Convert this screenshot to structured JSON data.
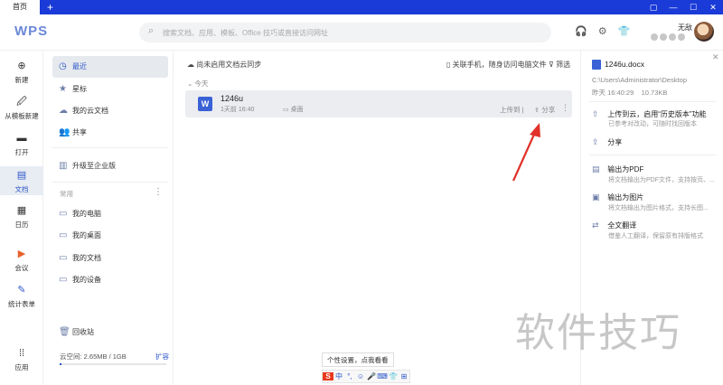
{
  "titlebar": {
    "home_tab": "首页",
    "new_tab_label": "+"
  },
  "header": {
    "logo": "WPS",
    "search_placeholder": "搜索文档、应用、模板、Office 技巧或直接访问网址",
    "user_name": "无敌"
  },
  "leftnav": {
    "items": [
      {
        "label": "新建",
        "icon": "plus-circle-icon"
      },
      {
        "label": "从模板新建",
        "icon": "template-icon"
      },
      {
        "label": "打开",
        "icon": "folder-icon"
      },
      {
        "label": "文档",
        "icon": "document-icon"
      },
      {
        "label": "日历",
        "icon": "calendar-icon"
      },
      {
        "label": "会议",
        "icon": "meeting-icon"
      },
      {
        "label": "统计表单",
        "icon": "form-icon"
      },
      {
        "label": "应用",
        "icon": "apps-icon"
      }
    ]
  },
  "panel": {
    "items": [
      {
        "label": "最近",
        "icon": "clock-icon"
      },
      {
        "label": "星标",
        "icon": "star-icon"
      },
      {
        "label": "我的云文档",
        "icon": "cloud-icon"
      },
      {
        "label": "共享",
        "icon": "people-icon"
      },
      {
        "label": "升级至企业版",
        "icon": "enterprise-icon"
      }
    ],
    "section_title": "常用",
    "common": [
      {
        "label": "我的电脑",
        "icon": "computer-icon"
      },
      {
        "label": "我的桌面",
        "icon": "desktop-icon"
      },
      {
        "label": "我的文档",
        "icon": "mydocs-icon"
      },
      {
        "label": "我的设备",
        "icon": "device-icon"
      }
    ],
    "trash": "回收站",
    "storage": "云空间: 2.65MB / 1GB",
    "expand": "扩容",
    "storage_fraction": 0.003
  },
  "main": {
    "cloud_tip": "尚未启用文档云同步",
    "assoc_phone": "关联手机，随身访问电脑文件",
    "filter": "筛选",
    "group_today": "今天",
    "file": {
      "name": "1246u",
      "time": "1天前 16:40",
      "location": "桌面",
      "upload": "上传到",
      "share": "分享"
    }
  },
  "rpanel": {
    "file_name": "1246u.docx",
    "path": "C:\\Users\\Administrator\\Desktop",
    "meta": "昨天 16:40:29    10.73KB",
    "upload_title": "上传到云，启用“历史版本”功能",
    "upload_sub": "已参考对改动，可随时找回版本",
    "share": "分享",
    "export_pdf": "输出为PDF",
    "export_pdf_sub": "将文档输出为PDF文件，支持按页、...",
    "export_img": "输出为图片",
    "export_img_sub": "将文档输出为图片格式，支持长图...",
    "translate": "全文翻译",
    "translate_sub": "借鉴人工翻译，保留原有排版格式"
  },
  "watermark": "软件技巧",
  "tooltip": "个性设置，点我看看",
  "tray": [
    "S",
    "中",
    "°,",
    "☺",
    "🎤",
    "⌨",
    "👕",
    "⊞"
  ],
  "colors": {
    "titlebar": "#1a3bd8",
    "accent": "#2c56c8",
    "arrow": "#e0312a"
  }
}
